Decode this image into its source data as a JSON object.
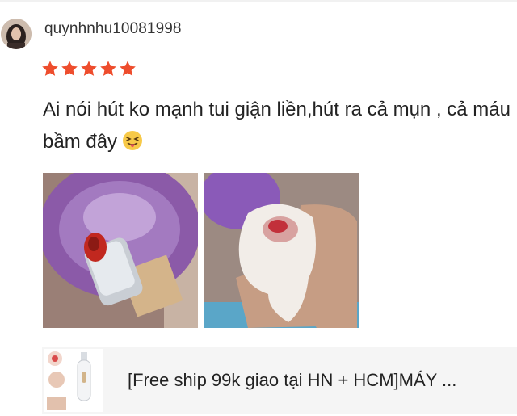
{
  "review": {
    "username": "quynhnhu10081998",
    "rating": 5,
    "text": "Ai nói hút ko mạnh tui giận liền,hút ra cả mụn , cả máu bầm đây",
    "emoji": "face-with-tongue-squinting",
    "photos": [
      {
        "name": "pore-vacuum-device-photo"
      },
      {
        "name": "tissue-with-blood-photo"
      }
    ]
  },
  "product": {
    "title": "[Free ship 99k giao tại HN + HCM]MÁY ..."
  },
  "colors": {
    "star": "#ee4d2d",
    "text": "#222222",
    "username": "#333333",
    "card_bg": "#f5f5f5"
  }
}
